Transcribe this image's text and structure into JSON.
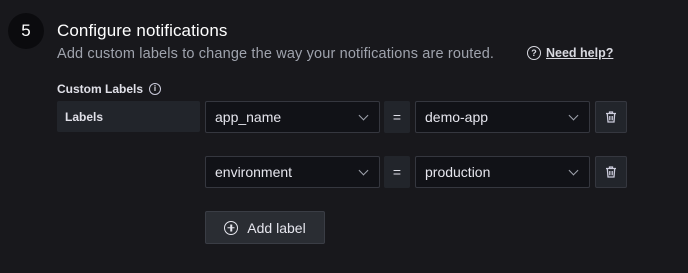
{
  "step": {
    "number": "5"
  },
  "section": {
    "title": "Configure notifications",
    "description": "Add custom labels to change the way your notifications are routed.",
    "help_link": "Need help?"
  },
  "custom_labels": {
    "label": "Custom Labels",
    "group_label": "Labels",
    "operator": "=",
    "rows": [
      {
        "key": "app_name",
        "value": "demo-app"
      },
      {
        "key": "environment",
        "value": "production"
      }
    ],
    "add_label": "Add label"
  },
  "icons": {
    "help": "question-circle-icon",
    "info": "info-circle-icon",
    "dropdown": "chevron-down-icon",
    "delete": "trash-icon",
    "add": "plus-circle-icon"
  },
  "colors": {
    "background": "#18181c",
    "input_background": "#111217",
    "border": "#35373f"
  }
}
